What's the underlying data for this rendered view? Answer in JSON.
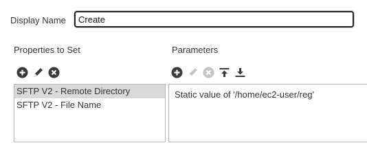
{
  "display_name": {
    "label": "Display Name",
    "value": "Create"
  },
  "properties": {
    "label": "Properties to Set",
    "toolbar": [
      "add-icon",
      "edit-icon",
      "remove-icon"
    ],
    "items": [
      {
        "label": "SFTP V2 - Remote Directory",
        "selected": true
      },
      {
        "label": "SFTP V2 - File Name",
        "selected": false
      }
    ]
  },
  "parameters": {
    "label": "Parameters",
    "toolbar": [
      "add-icon",
      "edit-icon-disabled",
      "remove-icon-disabled",
      "move-top-icon",
      "move-bottom-icon"
    ],
    "value_text": "Static value of '/home/ec2-user/reg'"
  },
  "colors": {
    "icon_active": "#3a3a3a",
    "icon_disabled": "#c4c4c4",
    "selection": "#d9d9d9"
  }
}
